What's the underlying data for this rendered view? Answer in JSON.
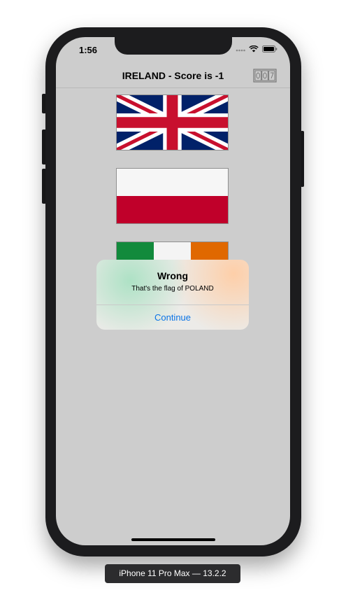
{
  "status_bar": {
    "time": "1:56"
  },
  "navbar": {
    "title": "IRELAND - Score is -1"
  },
  "flags": [
    {
      "name": "united-kingdom",
      "colors": [
        "#012169",
        "#ffffff",
        "#c8102e"
      ]
    },
    {
      "name": "poland",
      "colors": [
        "#ffffff",
        "#c0002a"
      ]
    },
    {
      "name": "ireland",
      "colors": [
        "#169b62",
        "#ffffff",
        "#ff883e"
      ]
    }
  ],
  "alert": {
    "title": "Wrong",
    "message": "That's the flag of POLAND",
    "button_label": "Continue"
  },
  "device_label": "iPhone 11 Pro Max — 13.2.2"
}
